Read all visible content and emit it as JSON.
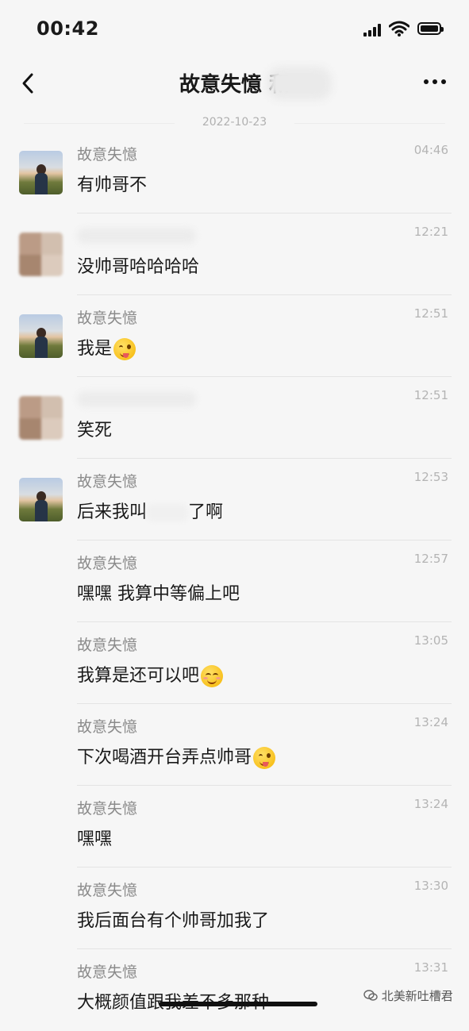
{
  "status_bar": {
    "time": "00:42"
  },
  "header": {
    "title": "故意失憶 和"
  },
  "date_separator": "2022-10-23",
  "messages": [
    {
      "sender": "故意失憶",
      "time": "04:46",
      "text": "有帅哥不",
      "avatar": "landscape-person"
    },
    {
      "sender": "",
      "time": "12:21",
      "text": "没帅哥哈哈哈哈",
      "avatar": "pixelated"
    },
    {
      "sender": "故意失憶",
      "time": "12:51",
      "text": "我是",
      "emoji": "winking-face-with-tongue",
      "avatar": "landscape-person"
    },
    {
      "sender": "",
      "time": "12:51",
      "text": "笑死",
      "avatar": "pixelated"
    },
    {
      "sender": "故意失憶",
      "time": "12:53",
      "text_before": "后来我叫",
      "text_after": "了啊",
      "avatar": "landscape-person"
    },
    {
      "sender": "故意失憶",
      "time": "12:57",
      "text": "嘿嘿 我算中等偏上吧"
    },
    {
      "sender": "故意失憶",
      "time": "13:05",
      "text": "我算是还可以吧",
      "emoji": "smiling-face"
    },
    {
      "sender": "故意失憶",
      "time": "13:24",
      "text": "下次喝酒开台弄点帅哥",
      "emoji": "winking-face-with-tongue"
    },
    {
      "sender": "故意失憶",
      "time": "13:24",
      "text": "嘿嘿"
    },
    {
      "sender": "故意失憶",
      "time": "13:30",
      "text": "我后面台有个帅哥加我了"
    },
    {
      "sender": "故意失憶",
      "time": "13:31",
      "text": "大概颜值跟我差不多那种"
    }
  ],
  "watermark": "北美新吐槽君"
}
